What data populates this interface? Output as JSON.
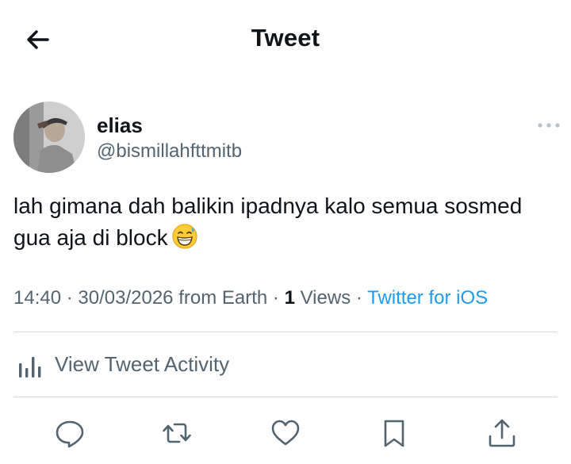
{
  "header": {
    "back_icon": "arrow-left-icon",
    "title": "Tweet"
  },
  "author": {
    "display_name": "elias",
    "handle": "@bismillahfttmitb",
    "avatar_icon": "avatar"
  },
  "tweet": {
    "text": "lah gimana dah balikin ipadnya kalo semua sosmed gua aja di block",
    "emoji": "grinning-face-with-sweat-emoji"
  },
  "meta": {
    "time": "14:40",
    "date": "30/03/2026",
    "location": "from Earth",
    "views_count": "1",
    "views_label": "Views",
    "source": "Twitter for iOS",
    "separator": "·"
  },
  "activity": {
    "label": "View Tweet Activity",
    "icon": "bar-chart-icon"
  },
  "actions": [
    {
      "name": "reply",
      "icon": "reply-icon"
    },
    {
      "name": "retweet",
      "icon": "retweet-icon"
    },
    {
      "name": "like",
      "icon": "heart-icon"
    },
    {
      "name": "bookmark",
      "icon": "bookmark-icon"
    },
    {
      "name": "share",
      "icon": "share-icon"
    }
  ],
  "colors": {
    "text": "#0f1419",
    "secondary": "#536471",
    "link": "#1d9bf0",
    "divider": "#cfd9de"
  }
}
